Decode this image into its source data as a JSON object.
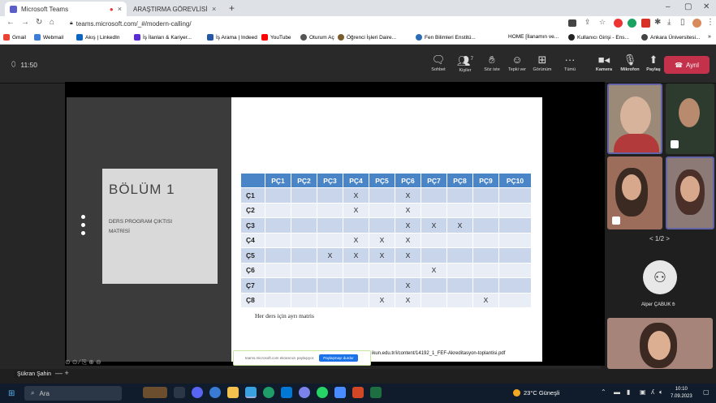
{
  "browser": {
    "tabs": [
      {
        "title": "Microsoft Teams"
      },
      {
        "title": "ARAŞTIRMA GÖREVLİSİ DUYGU"
      }
    ],
    "url": "teams.microsoft.com/_#/modern-calling/",
    "bookmarks": [
      "Gmail",
      "Webmail",
      "Akış | LinkedIn",
      "İş İlanları & Kariyer...",
      "İş Arama | Indeed",
      "YouTube",
      "Oturum Aç",
      "Öğrenci İşleri Daire...",
      "Fen Bilimleri Enstitü...",
      "HOME [İlanamın ve...",
      "Kullanıcı Girişi - Ens...",
      "Ankara Üniversitesi..."
    ]
  },
  "call": {
    "timer": "11:50",
    "toolbar": [
      {
        "label": "Sohbet",
        "icon": "chat-icon"
      },
      {
        "label": "Kişiler",
        "icon": "people-icon",
        "count": "7"
      },
      {
        "label": "Söz iste",
        "icon": "raise-hand-icon"
      },
      {
        "label": "Tepki ver",
        "icon": "react-icon"
      },
      {
        "label": "Görünüm",
        "icon": "view-icon"
      },
      {
        "label": "Tümü",
        "icon": "more-icon"
      },
      {
        "label": "Kamera",
        "icon": "camera-icon"
      },
      {
        "label": "Mikrofon",
        "icon": "mic-off-icon"
      },
      {
        "label": "Paylaş",
        "icon": "share-icon"
      }
    ],
    "leave_label": "Ayrıl",
    "presenter_name": "Şükran Şahin",
    "pager": "< 1/2 >",
    "participant_name": "Alper ÇABUK"
  },
  "slide": {
    "section_title": "BÖLÜM 1",
    "section_subtitle_line1": "DERS PROGRAM ÇIKTISI",
    "section_subtitle_line2": "MATRİSİ",
    "matrix_headers": [
      "",
      "PÇ1",
      "PÇ2",
      "PÇ3",
      "PÇ4",
      "PÇ5",
      "PÇ6",
      "PÇ7",
      "PÇ8",
      "PÇ9",
      "PÇ10"
    ],
    "matrix_rows": [
      [
        "Ç1",
        "",
        "",
        "",
        "X",
        "",
        "X",
        "",
        "",
        "",
        ""
      ],
      [
        "Ç2",
        "",
        "",
        "",
        "X",
        "",
        "X",
        "",
        "",
        "",
        ""
      ],
      [
        "Ç3",
        "",
        "",
        "",
        "",
        "",
        "X",
        "X",
        "X",
        "",
        ""
      ],
      [
        "Ç4",
        "",
        "",
        "",
        "X",
        "X",
        "X",
        "",
        "",
        "",
        ""
      ],
      [
        "Ç5",
        "",
        "",
        "X",
        "X",
        "X",
        "X",
        "",
        "",
        "",
        ""
      ],
      [
        "Ç6",
        "",
        "",
        "",
        "",
        "",
        "",
        "X",
        "",
        "",
        ""
      ],
      [
        "Ç7",
        "",
        "",
        "",
        "",
        "",
        "X",
        "",
        "",
        "",
        ""
      ],
      [
        "Ç8",
        "",
        "",
        "",
        "",
        "X",
        "X",
        "",
        "",
        "X",
        ""
      ]
    ],
    "note": "Her ders için ayrı matris",
    "pdf_url": "ikun.edu.tr/i/content/14192_1_FEF-Akreditasyon-toplantisi.pdf",
    "share_bar_text": "teams.microsoft.com ekranınızı paylaşıyor.",
    "share_bar_button": "Paylaşmayı durdur"
  },
  "taskbar": {
    "search_placeholder": "Ara",
    "weather": "23°C Güneşli",
    "time": "10:10",
    "date": "7.09.2023"
  }
}
